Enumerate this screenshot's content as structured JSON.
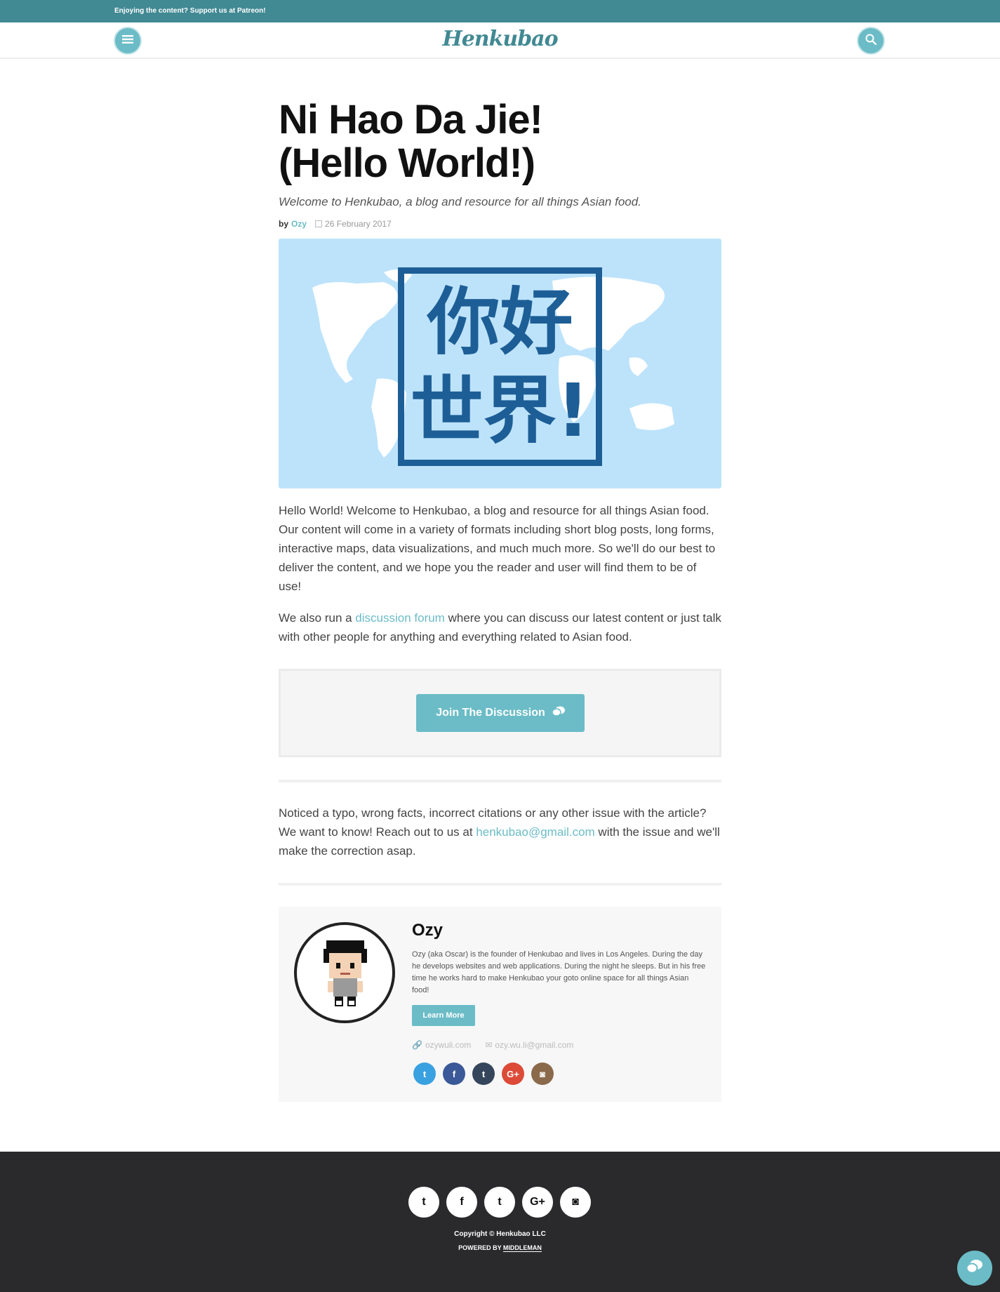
{
  "topbar": {
    "prefix": "Enjoying the content? Support us at ",
    "link": "Patreon!"
  },
  "header": {
    "logo": "Henkubao",
    "menu_icon": "menu-icon",
    "search_icon": "search-icon"
  },
  "article": {
    "title_line1": "Ni Hao Da Jie!",
    "title_line2": "(Hello World!)",
    "subtitle": "Welcome to Henkubao, a blog and resource for all things Asian food.",
    "by": "by",
    "author": "Ozy",
    "date": "26 February 2017",
    "hero_line1": "你好",
    "hero_line2": "世界!",
    "para1": "Hello World! Welcome to Henkubao, a blog and resource for all things Asian food. Our content will come in a variety of formats including short blog posts, long forms, interactive maps, data visualizations, and much much more. So we'll do our best to deliver the content, and we hope you the reader and user will find them to be of use!",
    "para2_prefix": "We also run a ",
    "para2_link": "discussion forum",
    "para2_suffix": " where you can discuss our latest content or just talk with other people for anything and everything related to Asian food.",
    "cta_label": "Join The Discussion",
    "notice_prefix": "Noticed a typo, wrong facts, incorrect citations or any other issue with the article? We want to know! Reach out to us at ",
    "notice_email": "henkubao@gmail.com",
    "notice_suffix": " with the issue and we'll make the correction asap."
  },
  "author_box": {
    "name": "Ozy",
    "bio": "Ozy (aka Oscar) is the founder of Henkubao and lives in Los Angeles. During the day he develops websites and web applications. During the night he sleeps. But in his free time he works hard to make Henkubao your goto online space for all things Asian food!",
    "learn_more": "Learn More",
    "website": "ozywuli.com",
    "email": "ozy.wu.li@gmail.com",
    "social": [
      {
        "name": "twitter-icon",
        "glyph": "t",
        "color": "#3aa1e0"
      },
      {
        "name": "facebook-icon",
        "glyph": "f",
        "color": "#3b5998"
      },
      {
        "name": "tumblr-icon",
        "glyph": "t",
        "color": "#35465c"
      },
      {
        "name": "google-plus-icon",
        "glyph": "G+",
        "color": "#dc4a38"
      },
      {
        "name": "instagram-icon",
        "glyph": "◙",
        "color": "#8a6a4b"
      }
    ]
  },
  "footer": {
    "social": [
      "twitter-icon",
      "facebook-icon",
      "tumblr-icon",
      "google-plus-icon",
      "instagram-icon"
    ],
    "social_glyphs": [
      "t",
      "f",
      "t",
      "G+",
      "◙"
    ],
    "copyright": "Copyright © Henkubao LLC",
    "powered_prefix": "POWERED BY ",
    "powered_link": "MIDDLEMAN"
  },
  "colors": {
    "accent": "#6bbcc7",
    "topbar": "#418993",
    "hero_bg": "#bde3fb",
    "hero_fg": "#1d5e96",
    "footer_bg": "#2a2a2c"
  }
}
